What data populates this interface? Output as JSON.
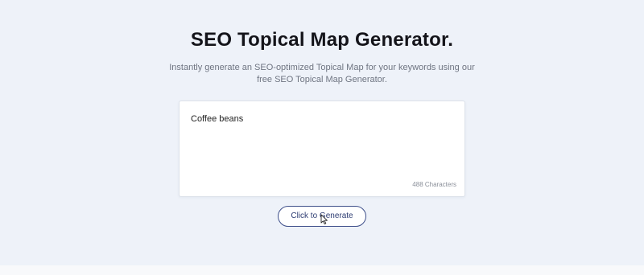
{
  "page": {
    "title": "SEO Topical Map Generator.",
    "subtitle": "Instantly generate an SEO-optimized Topical Map for your keywords using our free SEO Topical Map Generator."
  },
  "input": {
    "value": "Coffee beans",
    "char_count": "488 Characters"
  },
  "actions": {
    "generate_label": "Click to Generate"
  },
  "colors": {
    "hero_background": "#eef2f9",
    "button_border": "#3e4f8a",
    "title_text": "#14141a"
  },
  "icons": {
    "cursor": "pointer-cursor-icon"
  }
}
